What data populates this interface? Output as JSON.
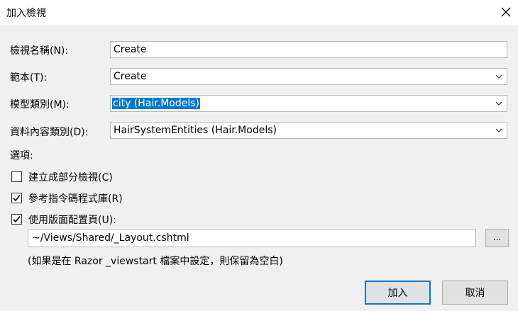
{
  "window": {
    "title": "加入檢視"
  },
  "form": {
    "view_name_label": "檢視名稱(N):",
    "view_name_value": "Create",
    "template_label": "範本(T):",
    "template_value": "Create",
    "model_class_label": "模型類別(M):",
    "model_class_value": "city (Hair.Models)",
    "data_context_label": "資料內容類別(D):",
    "data_context_value": "HairSystemEntities (Hair.Models)"
  },
  "options": {
    "heading": "選項:",
    "partial_view": {
      "label": "建立成部分檢視(C)",
      "checked": false
    },
    "reference_scripts": {
      "label": "參考指令碼程式庫(R)",
      "checked": true
    },
    "use_layout": {
      "label": "使用版面配置頁(U):",
      "checked": true
    },
    "layout_path": "~/Views/Shared/_Layout.cshtml",
    "browse_label": "...",
    "hint": "(如果是在 Razor _viewstart 檔案中設定，則保留為空白)"
  },
  "buttons": {
    "add": "加入",
    "cancel": "取消"
  },
  "icons": {
    "close": "close-icon",
    "dropdown": "chevron-down-icon",
    "check": "checkmark-icon"
  },
  "colors": {
    "selection": "#0078d7",
    "background": "#f0f0f0",
    "default_button_border": "#0078d7"
  }
}
